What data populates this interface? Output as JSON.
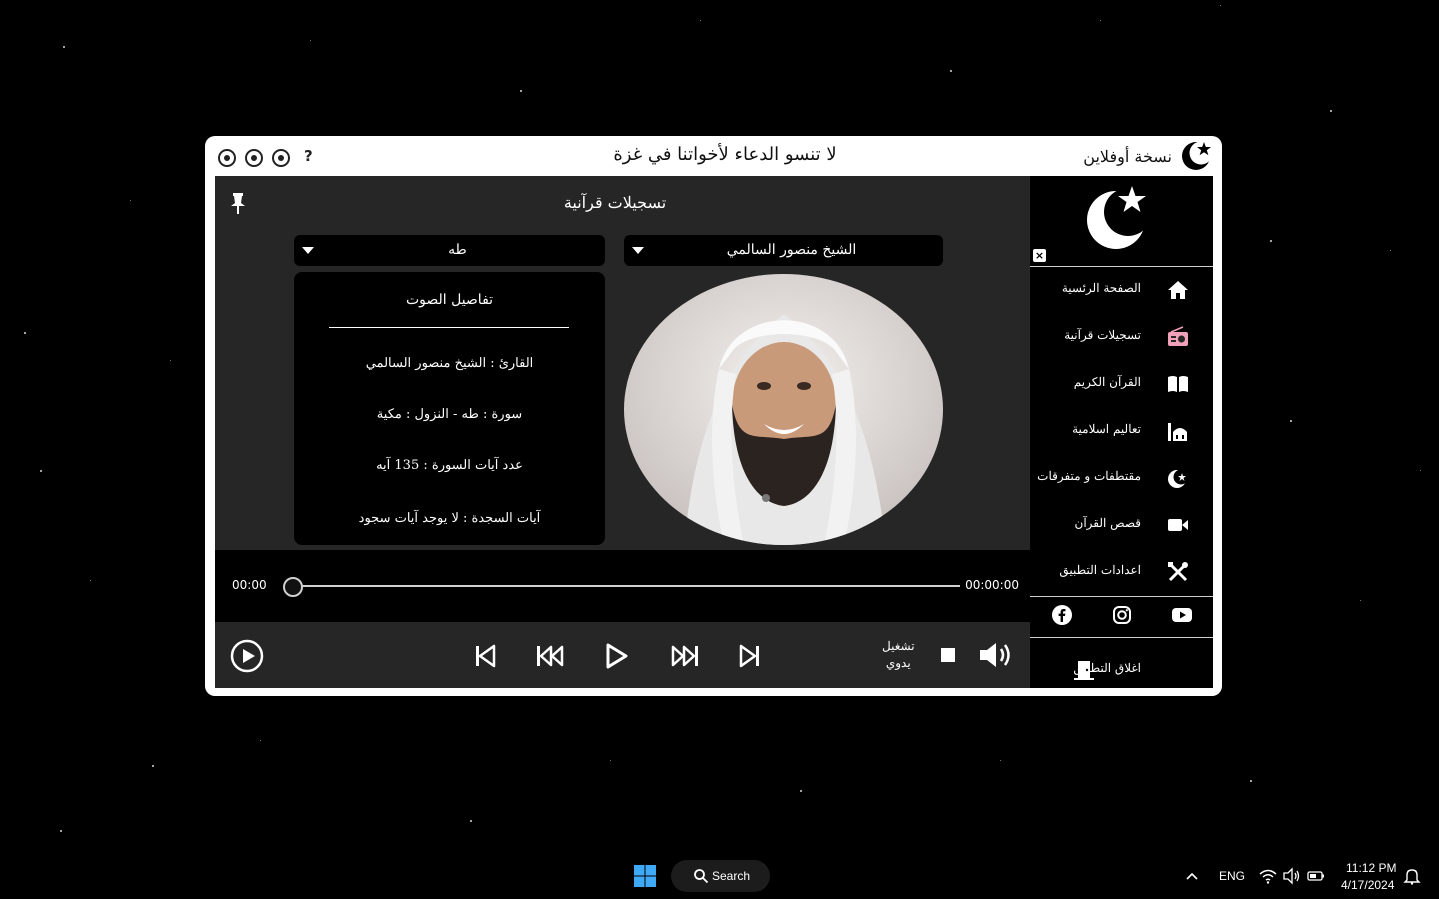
{
  "window": {
    "title_left_help": "?",
    "title_center": "لا تنسو الدعاء لأخواتنا في غزة",
    "title_right": "نسخة أوفلاين"
  },
  "sidebar": {
    "close_label": "×",
    "items": [
      {
        "label": "الصفحة الرئسية",
        "icon": "home-icon"
      },
      {
        "label": "تسجيلات قرآنية",
        "icon": "radio-icon",
        "active": true
      },
      {
        "label": "القرآن الكريم",
        "icon": "book-icon"
      },
      {
        "label": "تعاليم اسلامية",
        "icon": "mosque-icon"
      },
      {
        "label": "مقتطفات و متفرقات",
        "icon": "crescent-icon"
      },
      {
        "label": "قصص القرآن",
        "icon": "video-icon"
      },
      {
        "label": "اعدادات التطبيق",
        "icon": "tools-icon"
      }
    ],
    "social": [
      "facebook-icon",
      "instagram-icon",
      "youtube-icon"
    ],
    "exit_label": "اغلاق التطبيق"
  },
  "main": {
    "title": "تسجيلات قرآنية",
    "reciter_select": "الشيخ منصور السالمي",
    "surah_select": "طه",
    "details": {
      "title": "تفاصيل الصوت",
      "reciter": "القارئ : الشيخ منصور السالمي",
      "surah": "سورة  :  طه  -  النزول  :  مكية",
      "ayat_count": "عدد آيات السورة :  135  آيه",
      "sajda": "آيات السجدة  :  لا يوجد آيات سجود"
    }
  },
  "player": {
    "current_time": "00:00",
    "total_time": "00:00:00",
    "progress": 0,
    "mode_line1": "تشغيل",
    "mode_line2": "يدوي"
  },
  "taskbar": {
    "search_label": "Search",
    "language": "ENG",
    "time": "11:12 PM",
    "date": "4/17/2024"
  },
  "colors": {
    "accent": "#f0a0b8",
    "window_bg": "#ffffff",
    "panel_bg": "#262626",
    "sidebar_bg": "#000000"
  }
}
